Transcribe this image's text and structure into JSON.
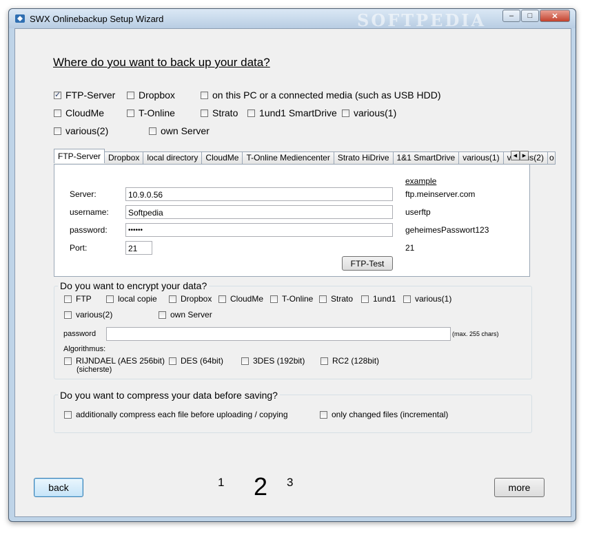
{
  "window": {
    "title": "SWX Onlinebackup Setup Wizard",
    "watermark": "SOFTPEDIA",
    "controls": {
      "minimize": "–",
      "maximize": "□",
      "close": "✕"
    }
  },
  "main": {
    "heading": "Where do you want to back up your data?",
    "targets": [
      {
        "label": "FTP-Server",
        "checked": true
      },
      {
        "label": "Dropbox",
        "checked": false
      },
      {
        "label": "on this PC or a connected media (such as USB HDD)",
        "checked": false
      },
      {
        "label": "CloudMe",
        "checked": false
      },
      {
        "label": "T-Online",
        "checked": false
      },
      {
        "label": "Strato",
        "checked": false
      },
      {
        "label": "1und1 SmartDrive",
        "checked": false
      },
      {
        "label": "various(1)",
        "checked": false
      },
      {
        "label": "various(2)",
        "checked": false
      },
      {
        "label": "own Server",
        "checked": false
      }
    ]
  },
  "tabs": {
    "items": [
      "FTP-Server",
      "Dropbox",
      "local directory",
      "CloudMe",
      "T-Online Mediencenter",
      "Strato HiDrive",
      "1&1 SmartDrive",
      "various(1)",
      "various(2)",
      "o"
    ],
    "active": "FTP-Server",
    "scroll_left": "◀",
    "scroll_right": "▶"
  },
  "ftp": {
    "example_header": "example",
    "server_label": "Server:",
    "server_value": "10.9.0.56",
    "server_example": "ftp.meinserver.com",
    "username_label": "username:",
    "username_value": "Softpedia",
    "username_example": "userftp",
    "password_label": "password:",
    "password_value": "••••••",
    "password_example": "geheimesPasswort123",
    "port_label": "Port:",
    "port_value": "21",
    "port_example": "21",
    "test_button": "FTP-Test"
  },
  "encrypt": {
    "title": "Do you want to encrypt your data?",
    "targets": [
      {
        "label": "FTP",
        "checked": false
      },
      {
        "label": "local copie",
        "checked": false
      },
      {
        "label": "Dropbox",
        "checked": false
      },
      {
        "label": "CloudMe",
        "checked": false
      },
      {
        "label": "T-Online",
        "checked": false
      },
      {
        "label": "Strato",
        "checked": false
      },
      {
        "label": "1und1",
        "checked": false
      },
      {
        "label": "various(1)",
        "checked": false
      },
      {
        "label": "various(2)",
        "checked": false
      },
      {
        "label": "own Server",
        "checked": false
      }
    ],
    "password_label": "password",
    "password_hint": "(max. 255 chars)",
    "algorithm_label": "Algorithmus:",
    "algorithms": [
      {
        "label": "RIJNDAEL (AES 256bit)",
        "note": "(sicherste)",
        "checked": false
      },
      {
        "label": "DES (64bit)",
        "checked": false
      },
      {
        "label": "3DES (192bit)",
        "checked": false
      },
      {
        "label": "RC2 (128bit)",
        "checked": false
      }
    ]
  },
  "compress": {
    "title": "Do you want to compress your data before saving?",
    "options": [
      {
        "label": "additionally compress each file before uploading / copying",
        "checked": false
      },
      {
        "label": "only changed files (incremental)",
        "checked": false
      }
    ]
  },
  "nav": {
    "back": "back",
    "more": "more",
    "pages": [
      "1",
      "2",
      "3"
    ],
    "current_page": "2"
  },
  "colors": {
    "titlebar": "#c8daed",
    "client": "#f0f0f0",
    "focus_border": "#3c7fb1"
  }
}
